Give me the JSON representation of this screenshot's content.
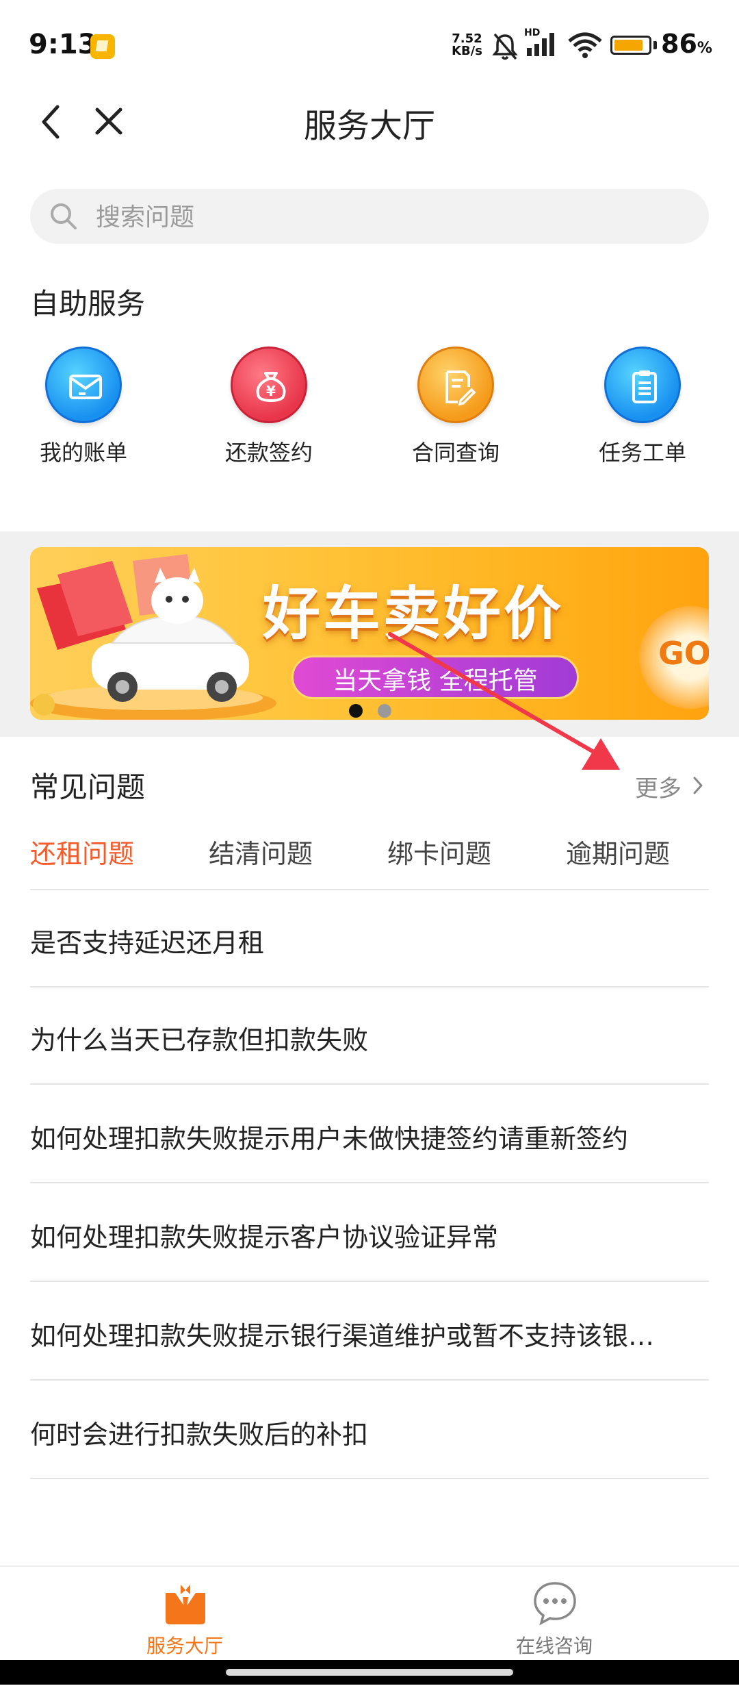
{
  "status_bar": {
    "time": "9:13",
    "net_speed_value": "7.52",
    "net_speed_unit": "KB/s",
    "hd_label": "HD",
    "battery_percent": "86",
    "battery_unit": "%",
    "battery_level": 0.86
  },
  "nav": {
    "title": "服务大厅"
  },
  "search": {
    "placeholder": "搜索问题"
  },
  "self_service": {
    "title": "自助服务",
    "items": [
      {
        "label": "我的账单",
        "icon": "mail-icon"
      },
      {
        "label": "还款签约",
        "icon": "money-bag-icon"
      },
      {
        "label": "合同查询",
        "icon": "document-edit-icon"
      },
      {
        "label": "任务工单",
        "icon": "clipboard-icon"
      }
    ]
  },
  "banner": {
    "headline": "好车卖好价",
    "subline": "当天拿钱 全程托管",
    "go_label": "GO",
    "slide_index": 1,
    "slide_count": 2
  },
  "faq": {
    "title": "常见问题",
    "more_label": "更多",
    "tabs": [
      {
        "label": "还租问题",
        "active": true
      },
      {
        "label": "结清问题",
        "active": false
      },
      {
        "label": "绑卡问题",
        "active": false
      },
      {
        "label": "逾期问题",
        "active": false
      }
    ],
    "questions": [
      "是否支持延迟还月租",
      "为什么当天已存款但扣款失败",
      "如何处理扣款失败提示用户未做快捷签约请重新签约",
      "如何处理扣款失败提示客户协议验证异常",
      "如何处理扣款失败提示银行渠道维护或暂不支持该银…",
      "何时会进行扣款失败后的补扣"
    ]
  },
  "bottom_nav": {
    "items": [
      {
        "label": "服务大厅",
        "active": true
      },
      {
        "label": "在线咨询",
        "active": false
      }
    ]
  },
  "colors": {
    "accent": "#f45a2a",
    "nav_active": "#f5761a",
    "annotation_arrow": "#f0384a"
  }
}
